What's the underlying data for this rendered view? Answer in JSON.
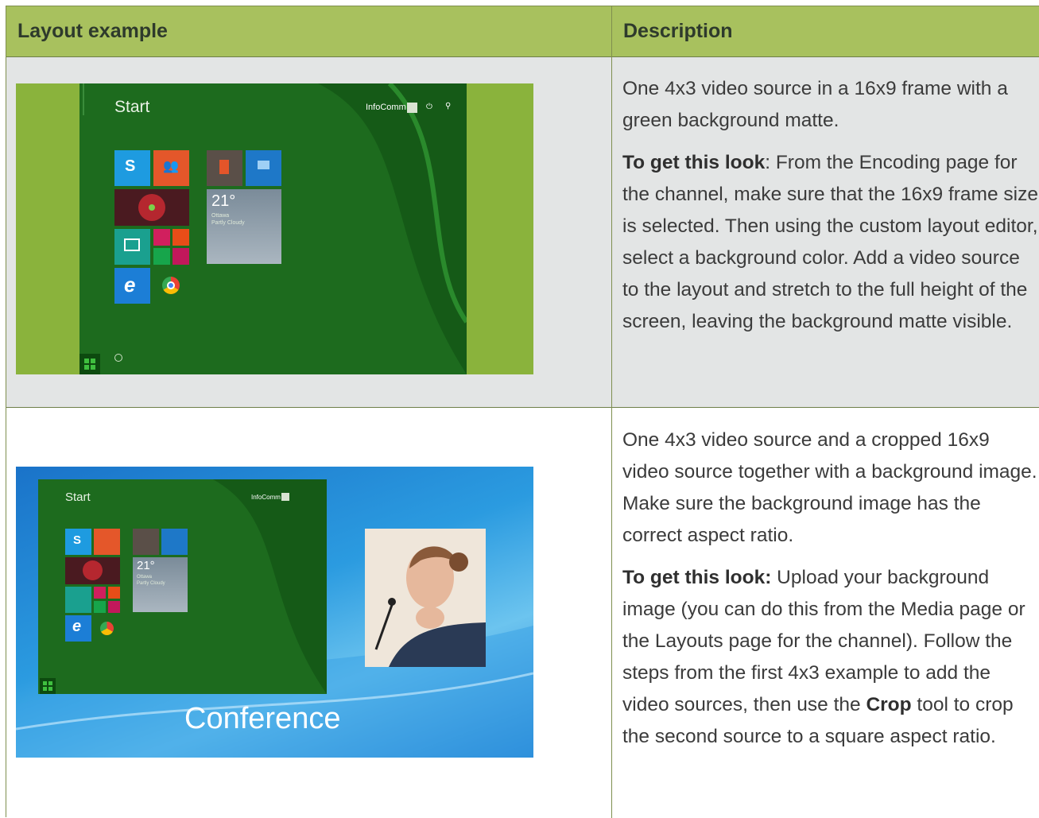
{
  "table": {
    "headers": [
      "Layout example",
      "Description"
    ],
    "rows": [
      {
        "example": {
          "start_label": "Start",
          "user_label": "InfoComm",
          "weather_temp": "21°",
          "weather_city": "Ottawa",
          "weather_condition": "Partly Cloudy"
        },
        "description": {
          "intro": "One 4x3 video source in a 16x9 frame with a green background matte.",
          "howto_bold": "To get this look",
          "howto_text": ": From the Encoding page for the channel, make sure that the 16x9 frame size is selected. Then using the custom layout editor, select a background color. Add a video source to the layout and stretch to the full height of the screen, leaving the background matte visible."
        }
      },
      {
        "example": {
          "start_label": "Start",
          "user_label": "InfoComm",
          "weather_temp": "21°",
          "weather_city": "Ottawa",
          "weather_condition": "Partly Cloudy",
          "banner_text": "Conference"
        },
        "description": {
          "intro": "One 4x3 video source and a cropped 16x9 video source together with a background image. Make sure the background image has the correct aspect ratio.",
          "howto_bold": "To get this look:",
          "howto_text_1": " Upload your background image (you can do this from the Media page or the Layouts page for the channel). Follow the steps from the first 4x3 example to add the video sources, then use the ",
          "crop_bold": "Crop",
          "howto_text_2": " tool to crop the second source to a square aspect ratio."
        }
      }
    ]
  },
  "colors": {
    "header_bg": "#a8c15e",
    "matte_green": "#8ab33c",
    "start_green": "#1d6b1e"
  }
}
